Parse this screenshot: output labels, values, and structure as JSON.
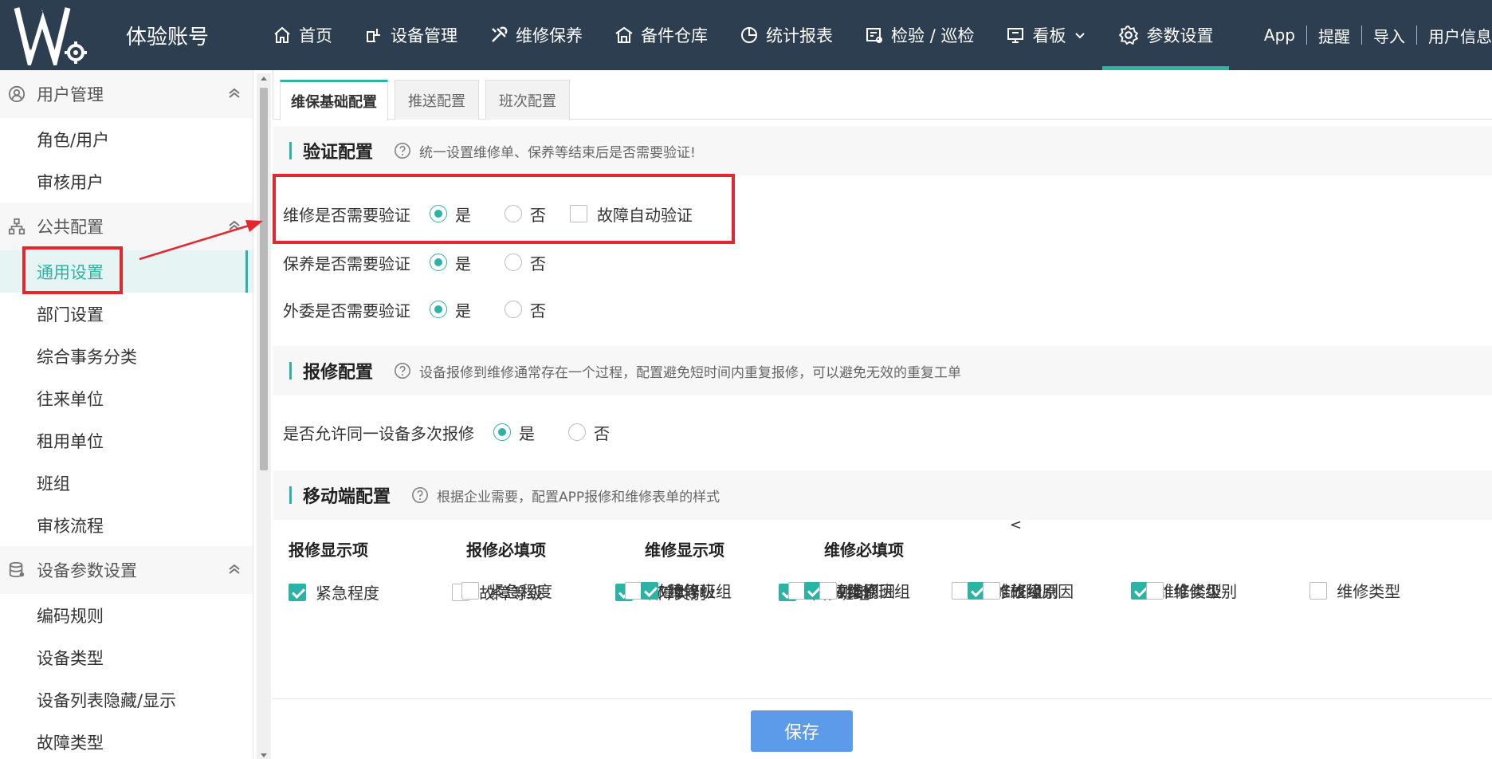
{
  "header": {
    "brand": "体验账号",
    "nav": [
      {
        "label": "首页",
        "icon": "home-icon"
      },
      {
        "label": "设备管理",
        "icon": "device-icon"
      },
      {
        "label": "维修保养",
        "icon": "tools-icon"
      },
      {
        "label": "备件仓库",
        "icon": "warehouse-icon"
      },
      {
        "label": "统计报表",
        "icon": "pie-chart-icon"
      },
      {
        "label": "检验 / 巡检",
        "icon": "inspection-icon"
      },
      {
        "label": "看板",
        "icon": "board-icon"
      },
      {
        "label": "参数设置",
        "icon": "gear-icon"
      }
    ],
    "right_links": [
      "App",
      "提醒",
      "导入",
      "用户信息"
    ]
  },
  "sidebar": {
    "groups": [
      {
        "title": "用户管理",
        "icon": "user-icon",
        "items": [
          "角色/用户",
          "审核用户"
        ]
      },
      {
        "title": "公共配置",
        "icon": "org-icon",
        "items": [
          "通用设置",
          "部门设置",
          "综合事务分类",
          "往来单位",
          "租用单位",
          "班组",
          "审核流程"
        ]
      },
      {
        "title": "设备参数设置",
        "icon": "database-icon",
        "items": [
          "编码规则",
          "设备类型",
          "设备列表隐藏/显示",
          "故障类型"
        ]
      }
    ],
    "active_item": "通用设置"
  },
  "tabs": [
    "维保基础配置",
    "推送配置",
    "班次配置"
  ],
  "verify": {
    "title": "验证配置",
    "hint": "统一设置维修单、保养等结束后是否需要验证!",
    "rows": [
      {
        "label": "维修是否需要验证",
        "yes": "是",
        "no": "否",
        "selected": "是",
        "extra_check": "故障自动验证",
        "extra_checked": false
      },
      {
        "label": "保养是否需要验证",
        "yes": "是",
        "no": "否",
        "selected": "是"
      },
      {
        "label": "外委是否需要验证",
        "yes": "是",
        "no": "否",
        "selected": "是"
      }
    ]
  },
  "report": {
    "title": "报修配置",
    "hint": "设备报修到维修通常存在一个过程，配置避免短时间内重复报修，可以避免无效的重复工单",
    "rows": [
      {
        "label": "是否允许同一设备多次报修",
        "yes": "是",
        "no": "否",
        "selected": "是"
      }
    ]
  },
  "mobile": {
    "title": "移动端配置",
    "hint": "根据企业需要，配置APP报修和维修表单的样式",
    "stray_char": "<",
    "columns": [
      {
        "title": "报修显示项",
        "items": [
          {
            "label": "紧急程度",
            "checked": true
          },
          {
            "label": "故障等级",
            "checked": false
          },
          {
            "label": "故障类别",
            "checked": true
          },
          {
            "label": "维修班组",
            "checked": true
          }
        ]
      },
      {
        "title": "报修必填项",
        "items": [
          {
            "label": "紧急程度",
            "checked": false
          },
          {
            "label": "故障等级",
            "checked": false
          },
          {
            "label": "故障类别",
            "checked": false
          },
          {
            "label": "维修班组",
            "checked": false
          }
        ]
      },
      {
        "title": "维修显示项",
        "items": [
          {
            "label": "维修班组",
            "checked": true
          },
          {
            "label": "故障原因",
            "checked": true
          },
          {
            "label": "维修级别",
            "checked": true
          },
          {
            "label": "维修类型",
            "checked": true
          }
        ]
      },
      {
        "title": "维修必填项",
        "items": [
          {
            "label": "维修班组",
            "checked": false
          },
          {
            "label": "故障原因",
            "checked": false
          },
          {
            "label": "维修级别",
            "checked": false
          },
          {
            "label": "维修类型",
            "checked": false
          }
        ]
      }
    ]
  },
  "footer": {
    "save_label": "保存"
  },
  "colors": {
    "header_bg": "#2c3e50",
    "accent": "#2bb3a5",
    "highlight_red": "#e5262f",
    "save_button": "#5b9bea"
  }
}
